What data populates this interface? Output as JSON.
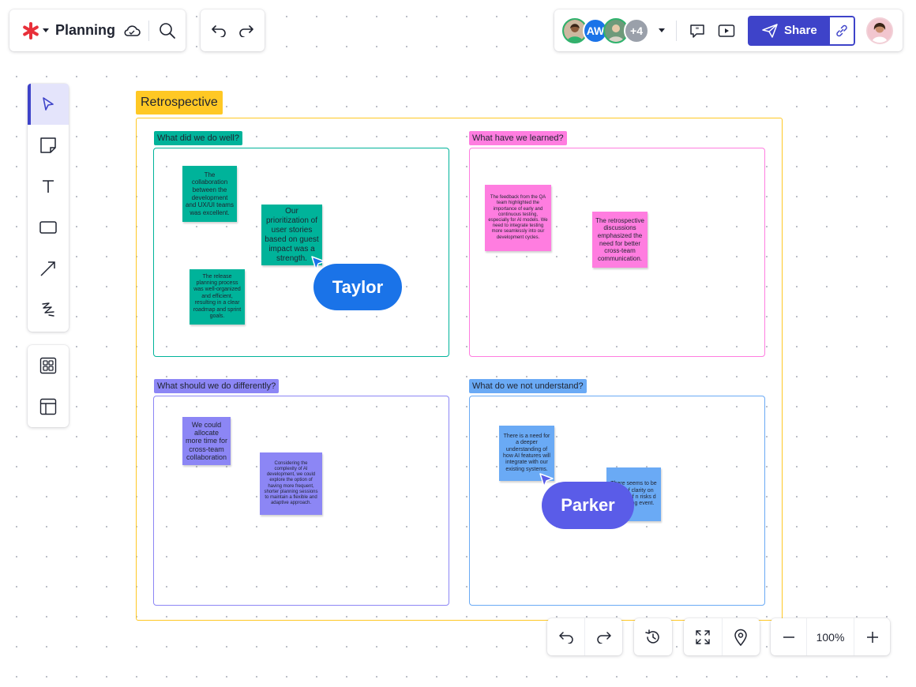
{
  "toolbar": {
    "title": "Planning",
    "collaborators": [
      {
        "initials": "",
        "color": "#7a5a44",
        "ring": "#2fb36d"
      },
      {
        "initials": "AW",
        "color": "#1a73e8",
        "ring": "#1a73e8"
      },
      {
        "initials": "",
        "color": "#5b8f6a",
        "ring": "#2fb36d"
      },
      {
        "initials": "+4",
        "color": "#9aa0aa",
        "ring": "#9aa0aa"
      }
    ],
    "share_label": "Share"
  },
  "frame": {
    "title": "Retrospective",
    "quadrants": [
      {
        "label": "What did we do well?",
        "color": "#00b39a",
        "notes": [
          "The collaboration between the development and UX/UI teams was excellent.",
          "Our prioritization of user stories based on guest impact was a strength.",
          "The release planning process was well-organized and efficient, resulting in a clear roadmap and sprint goals."
        ]
      },
      {
        "label": "What have we learned?",
        "color": "#ff7de0",
        "notes": [
          "The feedback from the QA team highlighted the importance of early and continuous testing, especially for AI models. We need to integrate testing more seamlessly into our development cycles.",
          "The retrospective discussions emphasized the need for better cross-team communication."
        ]
      },
      {
        "label": "What should we do differently?",
        "color": "#8c86f5",
        "notes": [
          "We could allocate more time for cross-team collaboration",
          "Considering the complexity of AI development, we could explore the option of having more frequent, shorter planning sessions to maintain a flexible and adaptive approach."
        ]
      },
      {
        "label": "What do we not understand?",
        "color": "#6aaaf5",
        "notes": [
          "There is a need for a deeper understanding of how AI features will integrate with our existing systems.",
          "There seems to be lack of clarity on impact of n risks d during ing event."
        ]
      }
    ]
  },
  "cursors": [
    {
      "name": "Taylor",
      "color": "#1a73e8"
    },
    {
      "name": "Parker",
      "color": "#5a5ce8"
    }
  ],
  "zoom": {
    "value": "100%"
  }
}
